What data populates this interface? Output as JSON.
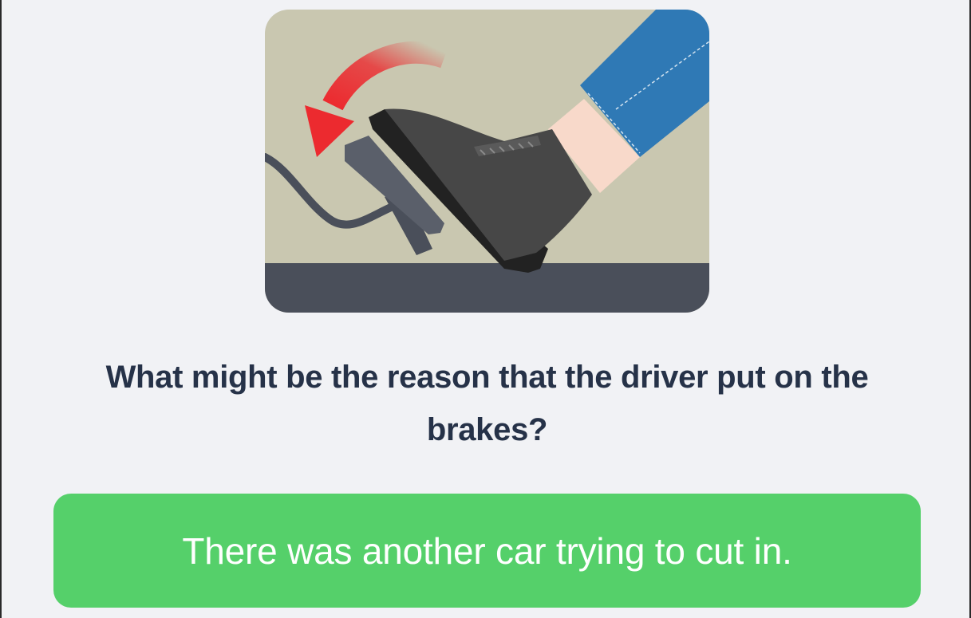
{
  "illustration": {
    "icon": "brake-pedal-illustration",
    "colors": {
      "background": "#c9c7b0",
      "floor": "#4a4f5a",
      "arrow": "#ec2a2f",
      "shoe": "#474747",
      "jeans": "#2f79b5",
      "skin": "#f8d9ca"
    }
  },
  "question": {
    "text": "What might be the reason that the driver put on the brakes?"
  },
  "answer": {
    "label": "There was another car trying to cut in.",
    "color": "#55d06a"
  }
}
